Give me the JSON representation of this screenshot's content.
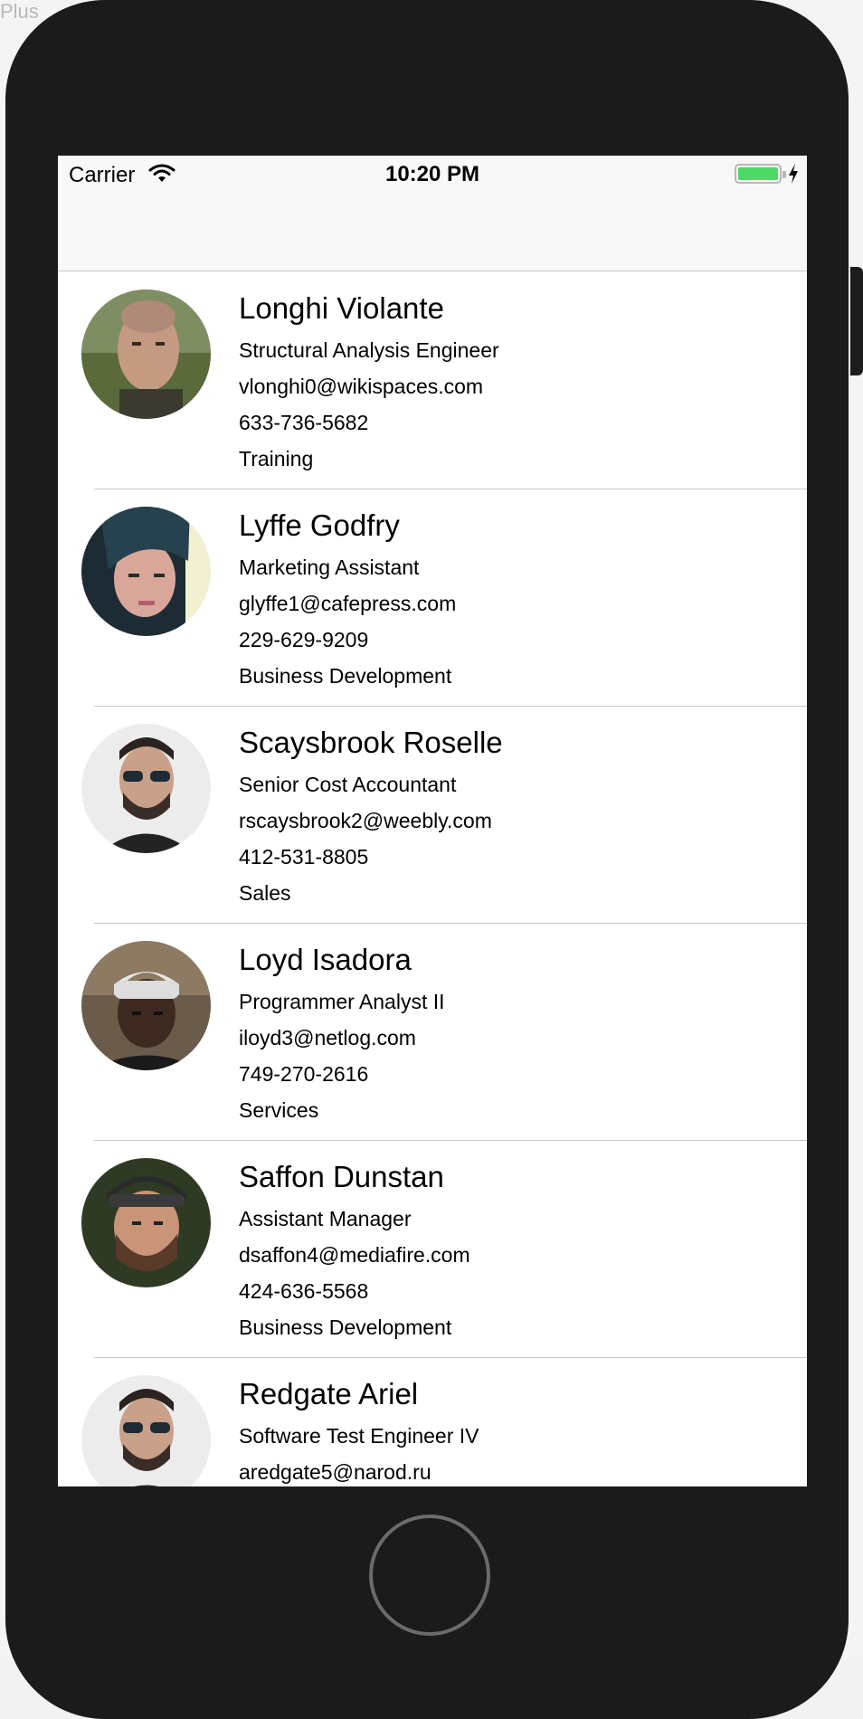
{
  "background": {
    "fragment": "Plus"
  },
  "statusbar": {
    "carrier": "Carrier",
    "time": "10:20 PM"
  },
  "contacts": [
    {
      "name": "Longhi Violante",
      "title": "Structural Analysis Engineer",
      "email": "vlonghi0@wikispaces.com",
      "phone": "633-736-5682",
      "department": "Training"
    },
    {
      "name": "Lyffe Godfry",
      "title": "Marketing Assistant",
      "email": "glyffe1@cafepress.com",
      "phone": "229-629-9209",
      "department": "Business Development"
    },
    {
      "name": "Scaysbrook Roselle",
      "title": "Senior Cost Accountant",
      "email": "rscaysbrook2@weebly.com",
      "phone": "412-531-8805",
      "department": "Sales"
    },
    {
      "name": "Loyd Isadora",
      "title": "Programmer Analyst II",
      "email": "iloyd3@netlog.com",
      "phone": "749-270-2616",
      "department": "Services"
    },
    {
      "name": "Saffon Dunstan",
      "title": "Assistant Manager",
      "email": "dsaffon4@mediafire.com",
      "phone": "424-636-5568",
      "department": "Business Development"
    },
    {
      "name": "Redgate Ariel",
      "title": "Software Test Engineer IV",
      "email": "aredgate5@narod.ru",
      "phone": "",
      "department": ""
    }
  ],
  "colors": {
    "battery": "#4cd964",
    "device": "#1b1b1c",
    "separator": "#c8c7cc"
  },
  "icons": [
    "wifi-icon",
    "battery-icon",
    "charging-bolt-icon"
  ]
}
